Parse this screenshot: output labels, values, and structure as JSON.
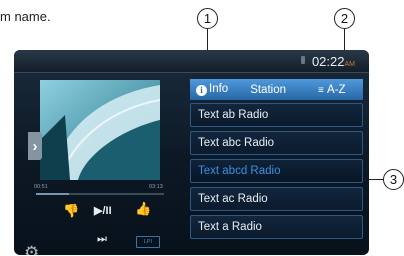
{
  "caption": {
    "intro": "m name."
  },
  "callouts": [
    "1",
    "2",
    "3"
  ],
  "status": {
    "time": "02:22",
    "ampm": "AM"
  },
  "player": {
    "time_elapsed": "00:51",
    "time_total": "03:13",
    "progress": 0.26,
    "buttons": {
      "like": "👎",
      "play_pause": "▶/II",
      "dislike": "👍",
      "next": "⏭",
      "lpi": "LPI"
    },
    "side_tab": "›",
    "settings": "⚙"
  },
  "tabs": {
    "info": "Info",
    "info_icon": "i",
    "station": "Station",
    "sort_icon": "≡",
    "sort": "A-Z"
  },
  "list": {
    "items": [
      {
        "label": "Text ab Radio",
        "selected": false
      },
      {
        "label": "Text abc Radio",
        "selected": false
      },
      {
        "label": "Text abcd Radio",
        "selected": true
      },
      {
        "label": "Text ac Radio",
        "selected": false
      },
      {
        "label": "Text a Radio",
        "selected": false
      }
    ]
  }
}
